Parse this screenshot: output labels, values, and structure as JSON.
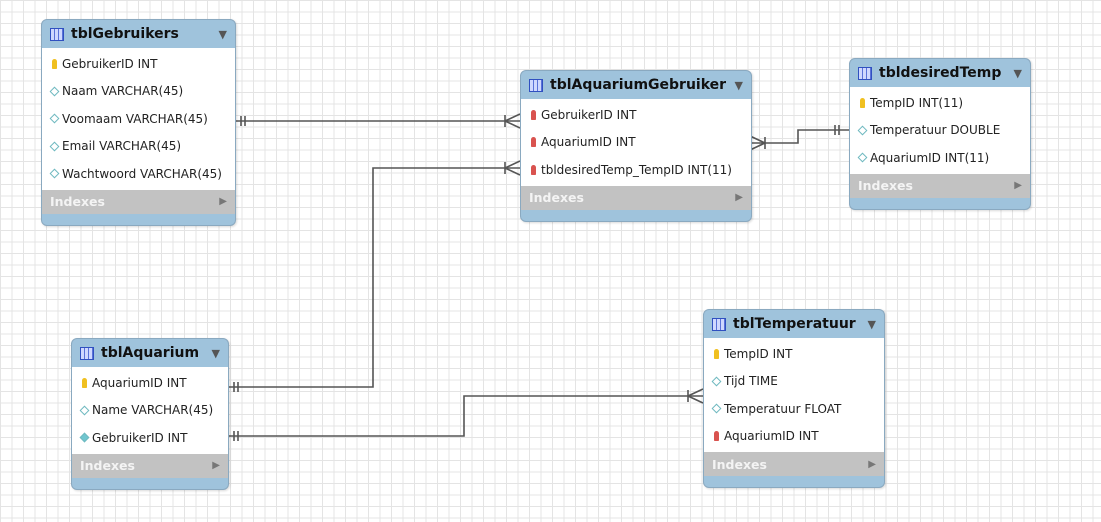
{
  "tables": [
    {
      "id": "gebruikers",
      "name": "tblGebruikers",
      "columns": [
        {
          "text": "GebruikerID INT",
          "icon": "primary-key"
        },
        {
          "text": "Naam VARCHAR(45)",
          "icon": "column"
        },
        {
          "text": "Voomaam VARCHAR(45)",
          "icon": "column"
        },
        {
          "text": "Email VARCHAR(45)",
          "icon": "column"
        },
        {
          "text": "Wachtwoord VARCHAR(45)",
          "icon": "column"
        }
      ],
      "indexes": "Indexes"
    },
    {
      "id": "aquariumgebruiker",
      "name": "tblAquariumGebruiker",
      "columns": [
        {
          "text": "GebruikerID INT",
          "icon": "foreign-key"
        },
        {
          "text": "AquariumID INT",
          "icon": "foreign-key"
        },
        {
          "text": "tbldesiredTemp_TempID INT(11)",
          "icon": "foreign-key"
        }
      ],
      "indexes": "Indexes"
    },
    {
      "id": "desiredtemp",
      "name": "tbldesiredTemp",
      "columns": [
        {
          "text": "TempID INT(11)",
          "icon": "primary-key"
        },
        {
          "text": "Temperatuur DOUBLE",
          "icon": "column"
        },
        {
          "text": "AquariumID INT(11)",
          "icon": "column"
        }
      ],
      "indexes": "Indexes"
    },
    {
      "id": "aquarium",
      "name": "tblAquarium",
      "columns": [
        {
          "text": "AquariumID INT",
          "icon": "primary-key"
        },
        {
          "text": "Name VARCHAR(45)",
          "icon": "column"
        },
        {
          "text": "GebruikerID INT",
          "icon": "indexed-column"
        }
      ],
      "indexes": "Indexes"
    },
    {
      "id": "temperatuur",
      "name": "tblTemperatuur",
      "columns": [
        {
          "text": "TempID INT",
          "icon": "primary-key"
        },
        {
          "text": "Tijd TIME",
          "icon": "column"
        },
        {
          "text": "Temperatuur FLOAT",
          "icon": "column"
        },
        {
          "text": "AquariumID INT",
          "icon": "foreign-key"
        }
      ],
      "indexes": "Indexes"
    }
  ],
  "relationships": [
    {
      "from": "tblGebruikers",
      "to": "tblAquariumGebruiker",
      "type": "one-to-many"
    },
    {
      "from": "tblAquarium",
      "to": "tblAquariumGebruiker",
      "type": "one-to-many"
    },
    {
      "from": "tbldesiredTemp",
      "to": "tblAquariumGebruiker",
      "type": "one-to-many"
    },
    {
      "from": "tblAquarium",
      "to": "tblTemperatuur",
      "type": "one-to-many"
    }
  ],
  "colors": {
    "header": "#9fc3dc",
    "primary_key": "#f0c020",
    "foreign_key": "#d9534f",
    "column": "#6fb9c0",
    "indexes_bar": "#c2c2c2"
  }
}
